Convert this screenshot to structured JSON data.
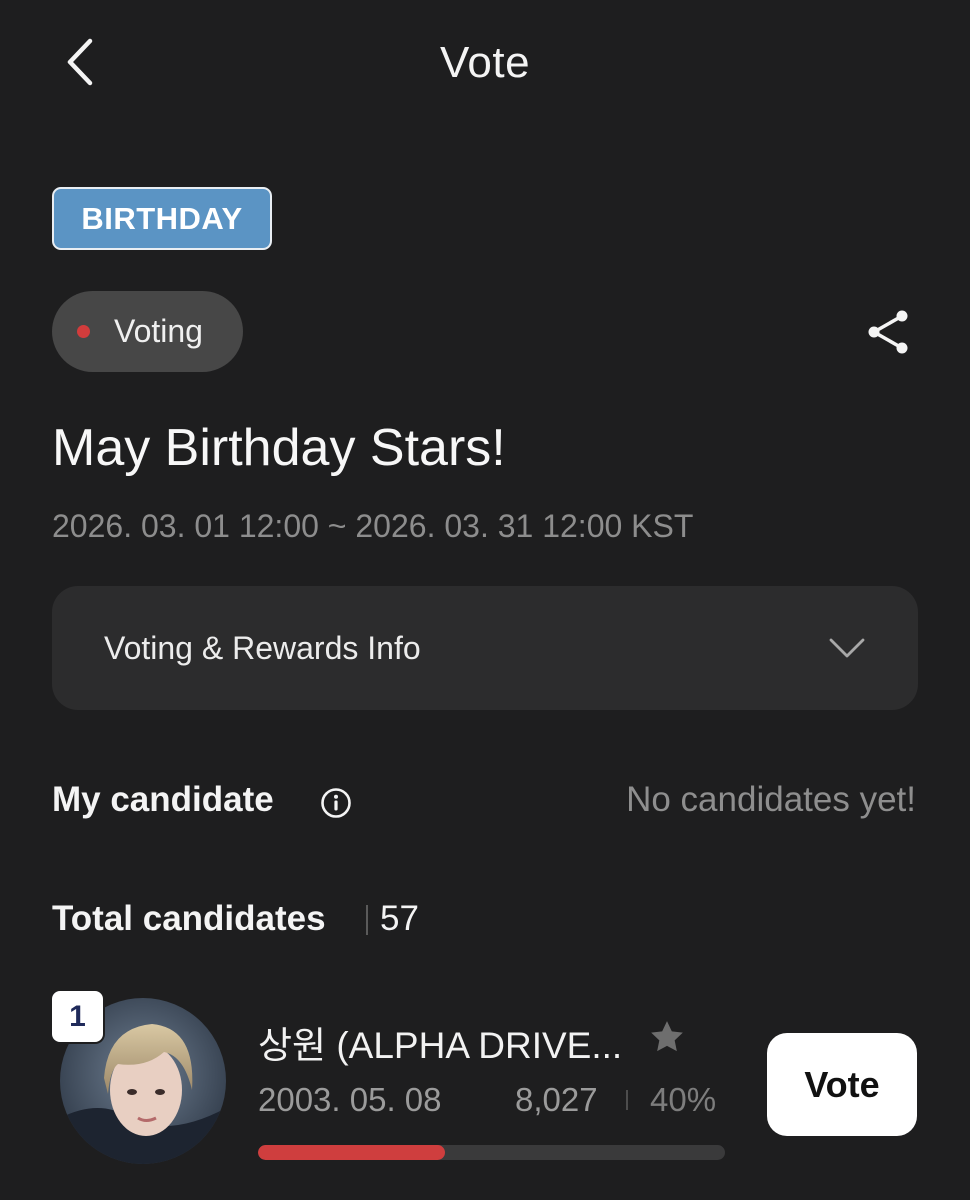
{
  "header": {
    "title": "Vote",
    "back_icon": "chevron-left-icon"
  },
  "event": {
    "category_badge": "BIRTHDAY",
    "status": "Voting",
    "status_color": "#d23c3c",
    "badge_color": "#5b94c4",
    "share_icon": "share-icon",
    "title": "May Birthday Stars!",
    "period": "2026. 03. 01 12:00 ~ 2026. 03. 31 12:00 KST"
  },
  "info_section": {
    "label": "Voting & Rewards Info",
    "expanded": false,
    "icon": "chevron-down-icon"
  },
  "my_candidate": {
    "label": "My candidate",
    "info_icon": "info-icon",
    "empty_text": "No candidates yet!"
  },
  "total": {
    "label": "Total candidates",
    "count": "57"
  },
  "candidates": [
    {
      "rank": "1",
      "name": "상원 (ALPHA DRIVE...",
      "dob": "2003. 05. 08",
      "votes": "8,027",
      "percent": "40%",
      "percent_value": 0.4,
      "favorite_icon": "star-icon",
      "vote_label": "Vote",
      "progress_color": "#cf3e3e"
    }
  ]
}
